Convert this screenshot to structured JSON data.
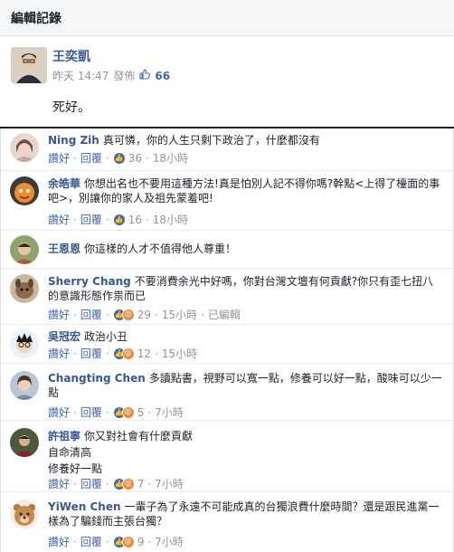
{
  "header": {
    "title": "編輯記錄"
  },
  "post": {
    "author": "王奕凱",
    "time": "昨天 14:47",
    "action": "發佈",
    "like_count": "66",
    "text": "死好。"
  },
  "labels": {
    "like": "讚好",
    "reply": "回覆",
    "edited": "已編輯"
  },
  "colors": {
    "link": "#4267b2",
    "name": "#365899",
    "meta": "#90949c",
    "like": "#4267b2",
    "angry": "#f0883a"
  },
  "comments": [
    {
      "name": "Ning Zih",
      "text": "真可憐，你的人生只剩下政治了，什麼都沒有",
      "count": "36",
      "time": "18小時",
      "avatar": "girl-avatar"
    },
    {
      "name": "余皓華",
      "text": "你想出名也不要用這種方法!真是怕別人記不得你嗎?幹點<上得了檯面的事吧>，別讓你的家人及祖先蒙羞吧!",
      "count": "16",
      "time": "18小時",
      "avatar": "cartoon-avatar"
    },
    {
      "name": "王恩恩",
      "text": "你這樣的人才不值得他人尊重！",
      "count": "",
      "time": "",
      "avatar": "child-avatar"
    },
    {
      "name": "Sherry Chang",
      "text": "不要消費余光中好嗎，你對台灣文壇有何貢獻?你只有歪七扭八的意識形態作祟而已",
      "count": "29",
      "time": "15小時",
      "edited": true,
      "avatar": "dog-avatar"
    },
    {
      "name": "吳冠宏",
      "text": "政治小丑",
      "count": "12",
      "time": "15小時",
      "avatar": "cartoon-boy-avatar"
    },
    {
      "name": "Changting Chen",
      "text": "多讀點書，視野可以寬一點，修養可以好一點，酸味可以少一點",
      "count": "5",
      "time": "7小時",
      "avatar": "woman-avatar"
    },
    {
      "name": "許祖寧",
      "text": "你又對社會有什麼貢獻",
      "extra_lines": [
        "自命清高",
        "修養好一點"
      ],
      "count": "7",
      "time": "7小時",
      "avatar": "man-avatar"
    },
    {
      "name": "YiWen Chen",
      "text": "一輩子為了永遠不可能成真的台獨浪費什麼時間？還是跟民進黨一樣為了騙錢而主張台獨？",
      "count": "9",
      "time": "7小時",
      "avatar": "bear-avatar"
    }
  ]
}
